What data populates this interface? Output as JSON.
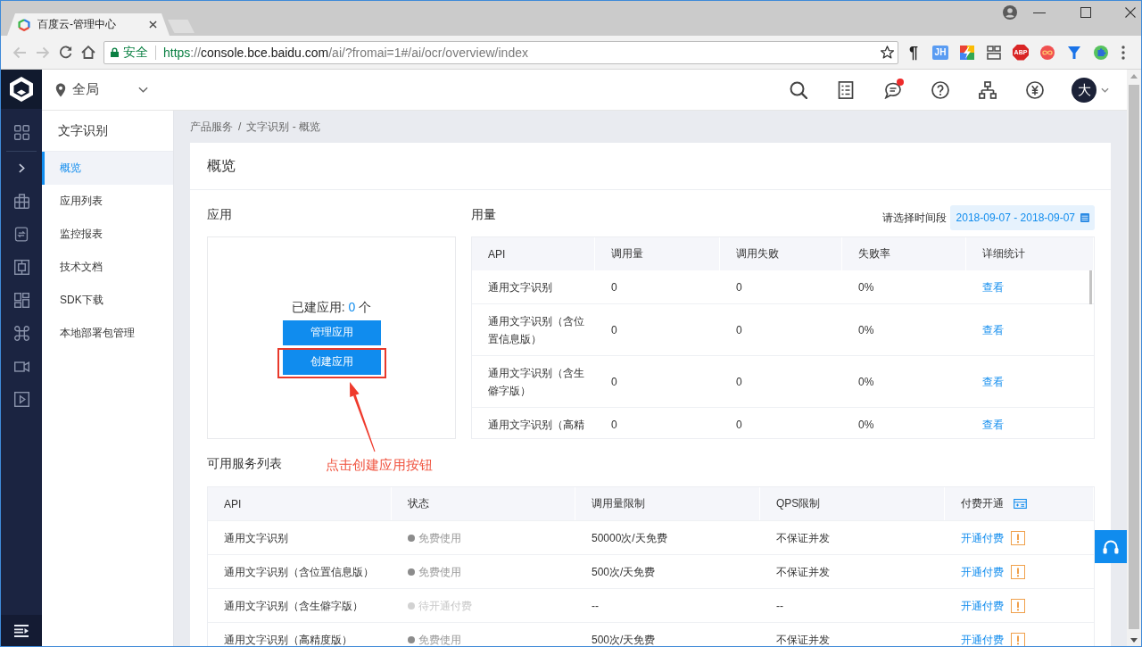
{
  "browser": {
    "tabs": [
      {
        "title": "百度云-管理中心",
        "selected": true
      }
    ],
    "nav_buttons": [
      {
        "kind": "back",
        "disabled": true
      },
      {
        "kind": "forward",
        "disabled": true
      },
      {
        "kind": "reload",
        "disabled": false
      },
      {
        "kind": "home",
        "disabled": false
      }
    ],
    "address_bar": {
      "security_label": "安全",
      "url": [
        {
          "kind": "scheme",
          "text": "https"
        },
        {
          "kind": "separator",
          "text": "://"
        },
        {
          "kind": "host",
          "text": "console.bce.baidu.com"
        },
        {
          "kind": "path",
          "text": "/ai/?fromai=1#/ai/ocr/overview/index"
        }
      ]
    },
    "extensions": [
      {
        "kind": "pilcrow",
        "label": "¶"
      },
      {
        "kind": "badge",
        "label": "JH"
      },
      {
        "kind": "lightning"
      },
      {
        "kind": "layout"
      },
      {
        "kind": "octagon",
        "label": "ABP"
      },
      {
        "kind": "infinity"
      },
      {
        "kind": "funnel"
      },
      {
        "kind": "puzzle"
      }
    ]
  },
  "header": {
    "region": "全局",
    "messages_unread": true,
    "user_initial": "大"
  },
  "sidebar": {
    "title": "文字识别",
    "items": [
      {
        "label": "概览",
        "selected": true
      },
      {
        "label": "应用列表",
        "selected": false
      },
      {
        "label": "监控报表",
        "selected": false
      },
      {
        "label": "技术文档",
        "selected": false
      },
      {
        "label": "SDK下载",
        "selected": false
      },
      {
        "label": "本地部署包管理",
        "selected": false
      }
    ]
  },
  "breadcrumb": {
    "items": [
      "产品服务",
      "文字识别 - 概览"
    ],
    "separator": "/"
  },
  "overview": {
    "title": "概览",
    "apps": {
      "title": "应用",
      "count_label": "已建应用:",
      "count": "0",
      "count_unit": "个",
      "buttons": [
        {
          "label": "管理应用",
          "highlighted": false
        },
        {
          "label": "创建应用",
          "highlighted": true
        }
      ]
    },
    "usage": {
      "title": "用量",
      "date_label": "请选择时间段",
      "date_range": "2018-09-07 - 2018-09-07",
      "columns": [
        "API",
        "调用量",
        "调用失败",
        "失败率",
        "详细统计"
      ],
      "rows": [
        {
          "api": "通用文字识别",
          "calls": "0",
          "failures": "0",
          "failure_rate": "0%",
          "action": "查看"
        },
        {
          "api": "通用文字识别（含位置信息版）",
          "calls": "0",
          "failures": "0",
          "failure_rate": "0%",
          "action": "查看"
        },
        {
          "api": "通用文字识别（含生僻字版）",
          "calls": "0",
          "failures": "0",
          "failure_rate": "0%",
          "action": "查看"
        },
        {
          "api": "通用文字识别（高精",
          "calls": "0",
          "failures": "0",
          "failure_rate": "0%",
          "action": "查看"
        }
      ]
    },
    "services": {
      "title": "可用服务列表",
      "columns": [
        "API",
        "状态",
        "调用量限制",
        "QPS限制",
        "付费开通"
      ],
      "rows": [
        {
          "api": "通用文字识别",
          "status": "免费使用",
          "active": true,
          "quota": "50000次/天免费",
          "qps": "不保证并发",
          "action": "开通付费"
        },
        {
          "api": "通用文字识别（含位置信息版）",
          "status": "免费使用",
          "active": true,
          "quota": "500次/天免费",
          "qps": "不保证并发",
          "action": "开通付费"
        },
        {
          "api": "通用文字识别（含生僻字版）",
          "status": "待开通付费",
          "active": false,
          "quota": "--",
          "qps": "--",
          "action": "开通付费"
        },
        {
          "api": "通用文字识别（高精度版）",
          "status": "免费使用",
          "active": true,
          "quota": "500次/天免费",
          "qps": "不保证并发",
          "action": "开通付费"
        }
      ]
    }
  },
  "annotation": {
    "text": "点击创建应用按钮"
  }
}
